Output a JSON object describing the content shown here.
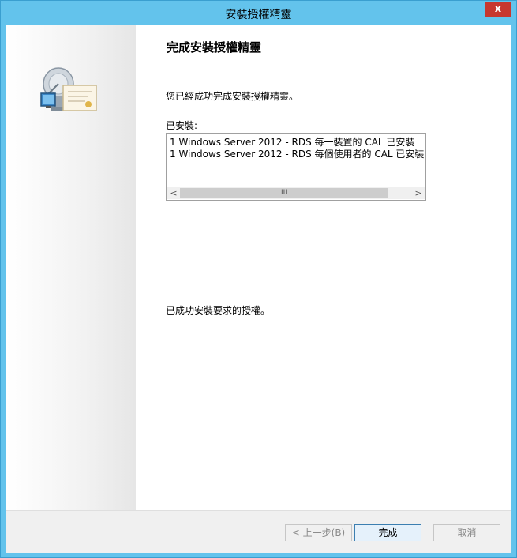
{
  "window": {
    "title": "安裝授權精靈",
    "close_symbol": "x"
  },
  "content": {
    "heading": "完成安裝授權精靈",
    "success_message": "您已經成功完成安裝授權精靈。",
    "installed_label": "已安裝:",
    "installed_items": [
      "1 Windows Server 2012 - RDS 每一裝置的 CAL 已安裝",
      "1 Windows Server 2012 - RDS 每個使用者的 CAL 已安裝"
    ],
    "footer_message": "已成功安裝要求的授權。"
  },
  "scrollbar": {
    "left_arrow": "<",
    "right_arrow": ">",
    "thumb_grip": "III"
  },
  "buttons": {
    "back": "< 上一步(B)",
    "finish": "完成",
    "cancel": "取消"
  }
}
